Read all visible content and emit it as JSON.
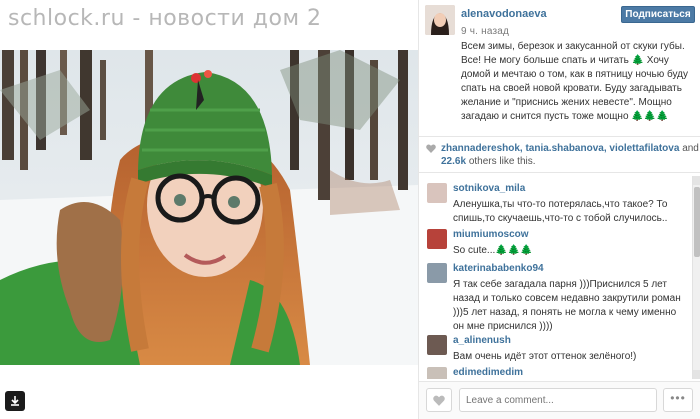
{
  "watermark": "schlock.ru - новости дом 2",
  "post": {
    "username": "alenavodonaeva",
    "time": "9 ч. назад",
    "follow_label": "Подписаться",
    "caption": "Всем зимы, березок и закусанной от скуки губы. Все! Не могу больше спать и читать 🌲 Хочу домой и мечтаю о том, как в пятницу ночью буду спать на своей новой кровати. Буду загадывать желание и \"приснись жених невесте\". Мощно загадаю и снится пусть тоже мощно 🌲🌲🌲"
  },
  "likes": {
    "users": "zhannadereshok, tania.shabanova, violettafilatova",
    "and": "and",
    "count": "22.6k",
    "suffix": "others like this."
  },
  "comments": [
    {
      "user": "sotnikova_mila",
      "text": "Аленушка,ты что-то потерялась,что такое? То спишь,то скучаешь,что-то с тобой случилось..",
      "avatar_color": "#d9c4bd"
    },
    {
      "user": "miumiumoscow",
      "text": "So cute...🌲🌲🌲",
      "avatar_color": "#b7423a"
    },
    {
      "user": "katerinababenko94",
      "text": "Я так себе загадала парня )))Приснился 5 лет назад и только совсем недавно закрутили роман )))5 лет назад, я понять не могла к чему именно он мне приснился ))))",
      "avatar_color": "#8a9aa8"
    },
    {
      "user": "a_alinenush",
      "text": "Вам очень идёт этот оттенок зелёного!)",
      "avatar_color": "#6d5a52"
    },
    {
      "user": "edimedimedim",
      "text": "",
      "avatar_color": "#c9c0b8"
    }
  ],
  "footer": {
    "comment_placeholder": "Leave a comment...",
    "more_label": "•••"
  },
  "colors": {
    "link": "#3f729b",
    "follow_button": "#4c7aa5",
    "hat": "#3f8a3a",
    "jacket": "#3b9a3c"
  },
  "icons": [
    "download-icon",
    "heart-icon",
    "more-icon"
  ]
}
